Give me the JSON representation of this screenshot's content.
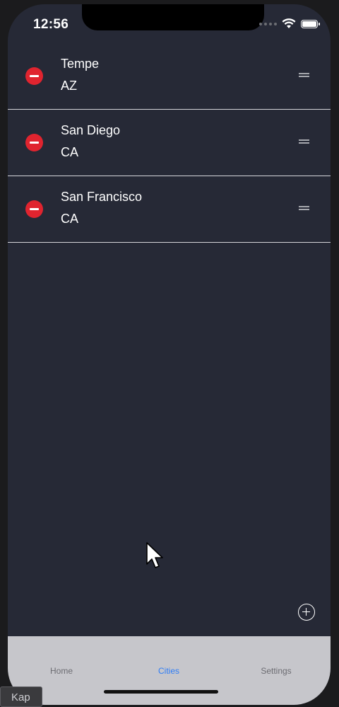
{
  "status_bar": {
    "time": "12:56"
  },
  "cities": [
    {
      "name": "Tempe",
      "state": "AZ"
    },
    {
      "name": "San Diego",
      "state": "CA"
    },
    {
      "name": "San Francisco",
      "state": "CA"
    }
  ],
  "tabs": [
    {
      "label": "Home",
      "active": false
    },
    {
      "label": "Cities",
      "active": true
    },
    {
      "label": "Settings",
      "active": false
    }
  ],
  "overlay": {
    "kap_label": "Kap"
  },
  "colors": {
    "background": "#262936",
    "delete": "#e0242f",
    "tab_active": "#2f7df6",
    "tab_inactive": "#6c6c72",
    "tab_bar": "#c6c6cb"
  },
  "icons": [
    "wifi-icon",
    "battery-icon",
    "delete-icon",
    "reorder-icon",
    "add-icon",
    "cursor-icon"
  ]
}
